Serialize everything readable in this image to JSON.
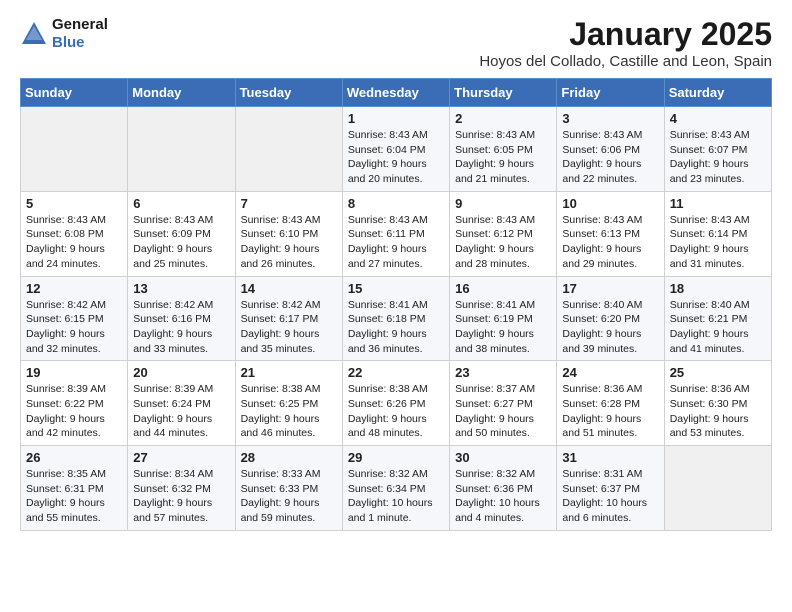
{
  "logo": {
    "line1": "General",
    "line2": "Blue"
  },
  "title": "January 2025",
  "subtitle": "Hoyos del Collado, Castille and Leon, Spain",
  "weekdays": [
    "Sunday",
    "Monday",
    "Tuesday",
    "Wednesday",
    "Thursday",
    "Friday",
    "Saturday"
  ],
  "weeks": [
    [
      {
        "day": "",
        "info": ""
      },
      {
        "day": "",
        "info": ""
      },
      {
        "day": "",
        "info": ""
      },
      {
        "day": "1",
        "info": "Sunrise: 8:43 AM\nSunset: 6:04 PM\nDaylight: 9 hours\nand 20 minutes."
      },
      {
        "day": "2",
        "info": "Sunrise: 8:43 AM\nSunset: 6:05 PM\nDaylight: 9 hours\nand 21 minutes."
      },
      {
        "day": "3",
        "info": "Sunrise: 8:43 AM\nSunset: 6:06 PM\nDaylight: 9 hours\nand 22 minutes."
      },
      {
        "day": "4",
        "info": "Sunrise: 8:43 AM\nSunset: 6:07 PM\nDaylight: 9 hours\nand 23 minutes."
      }
    ],
    [
      {
        "day": "5",
        "info": "Sunrise: 8:43 AM\nSunset: 6:08 PM\nDaylight: 9 hours\nand 24 minutes."
      },
      {
        "day": "6",
        "info": "Sunrise: 8:43 AM\nSunset: 6:09 PM\nDaylight: 9 hours\nand 25 minutes."
      },
      {
        "day": "7",
        "info": "Sunrise: 8:43 AM\nSunset: 6:10 PM\nDaylight: 9 hours\nand 26 minutes."
      },
      {
        "day": "8",
        "info": "Sunrise: 8:43 AM\nSunset: 6:11 PM\nDaylight: 9 hours\nand 27 minutes."
      },
      {
        "day": "9",
        "info": "Sunrise: 8:43 AM\nSunset: 6:12 PM\nDaylight: 9 hours\nand 28 minutes."
      },
      {
        "day": "10",
        "info": "Sunrise: 8:43 AM\nSunset: 6:13 PM\nDaylight: 9 hours\nand 29 minutes."
      },
      {
        "day": "11",
        "info": "Sunrise: 8:43 AM\nSunset: 6:14 PM\nDaylight: 9 hours\nand 31 minutes."
      }
    ],
    [
      {
        "day": "12",
        "info": "Sunrise: 8:42 AM\nSunset: 6:15 PM\nDaylight: 9 hours\nand 32 minutes."
      },
      {
        "day": "13",
        "info": "Sunrise: 8:42 AM\nSunset: 6:16 PM\nDaylight: 9 hours\nand 33 minutes."
      },
      {
        "day": "14",
        "info": "Sunrise: 8:42 AM\nSunset: 6:17 PM\nDaylight: 9 hours\nand 35 minutes."
      },
      {
        "day": "15",
        "info": "Sunrise: 8:41 AM\nSunset: 6:18 PM\nDaylight: 9 hours\nand 36 minutes."
      },
      {
        "day": "16",
        "info": "Sunrise: 8:41 AM\nSunset: 6:19 PM\nDaylight: 9 hours\nand 38 minutes."
      },
      {
        "day": "17",
        "info": "Sunrise: 8:40 AM\nSunset: 6:20 PM\nDaylight: 9 hours\nand 39 minutes."
      },
      {
        "day": "18",
        "info": "Sunrise: 8:40 AM\nSunset: 6:21 PM\nDaylight: 9 hours\nand 41 minutes."
      }
    ],
    [
      {
        "day": "19",
        "info": "Sunrise: 8:39 AM\nSunset: 6:22 PM\nDaylight: 9 hours\nand 42 minutes."
      },
      {
        "day": "20",
        "info": "Sunrise: 8:39 AM\nSunset: 6:24 PM\nDaylight: 9 hours\nand 44 minutes."
      },
      {
        "day": "21",
        "info": "Sunrise: 8:38 AM\nSunset: 6:25 PM\nDaylight: 9 hours\nand 46 minutes."
      },
      {
        "day": "22",
        "info": "Sunrise: 8:38 AM\nSunset: 6:26 PM\nDaylight: 9 hours\nand 48 minutes."
      },
      {
        "day": "23",
        "info": "Sunrise: 8:37 AM\nSunset: 6:27 PM\nDaylight: 9 hours\nand 50 minutes."
      },
      {
        "day": "24",
        "info": "Sunrise: 8:36 AM\nSunset: 6:28 PM\nDaylight: 9 hours\nand 51 minutes."
      },
      {
        "day": "25",
        "info": "Sunrise: 8:36 AM\nSunset: 6:30 PM\nDaylight: 9 hours\nand 53 minutes."
      }
    ],
    [
      {
        "day": "26",
        "info": "Sunrise: 8:35 AM\nSunset: 6:31 PM\nDaylight: 9 hours\nand 55 minutes."
      },
      {
        "day": "27",
        "info": "Sunrise: 8:34 AM\nSunset: 6:32 PM\nDaylight: 9 hours\nand 57 minutes."
      },
      {
        "day": "28",
        "info": "Sunrise: 8:33 AM\nSunset: 6:33 PM\nDaylight: 9 hours\nand 59 minutes."
      },
      {
        "day": "29",
        "info": "Sunrise: 8:32 AM\nSunset: 6:34 PM\nDaylight: 10 hours\nand 1 minute."
      },
      {
        "day": "30",
        "info": "Sunrise: 8:32 AM\nSunset: 6:36 PM\nDaylight: 10 hours\nand 4 minutes."
      },
      {
        "day": "31",
        "info": "Sunrise: 8:31 AM\nSunset: 6:37 PM\nDaylight: 10 hours\nand 6 minutes."
      },
      {
        "day": "",
        "info": ""
      }
    ]
  ]
}
